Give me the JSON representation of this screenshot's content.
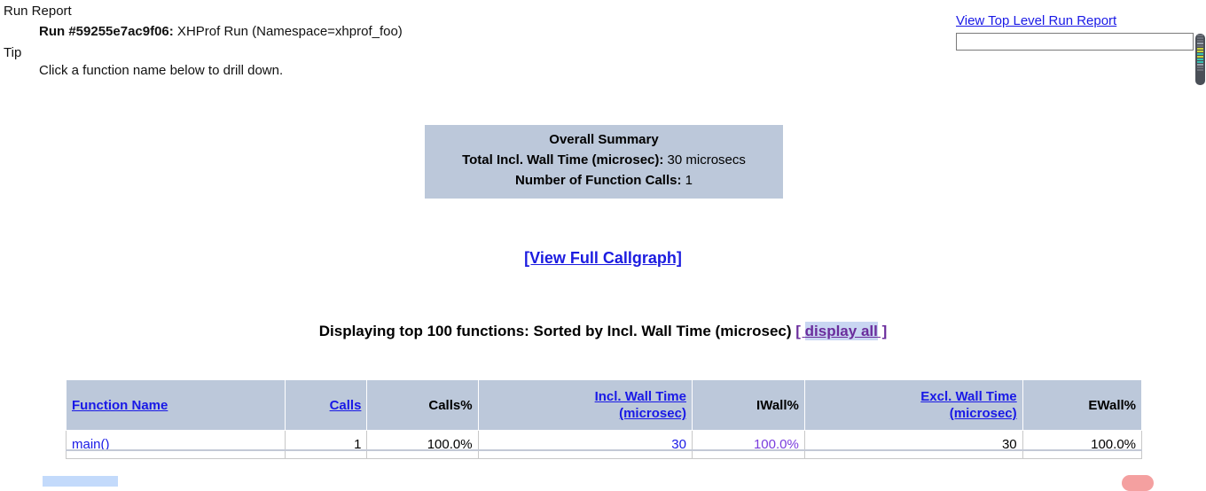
{
  "header": {
    "run_report_label": "Run Report",
    "run_id_label": "Run #59255e7ac9f06:",
    "run_description": " XHProf Run (Namespace=xhprof_foo)",
    "tip_label": "Tip",
    "tip_text": "Click a function name below to drill down."
  },
  "top_right": {
    "view_top_level_link": "View Top Level Run Report",
    "search_value": "",
    "search_placeholder": ""
  },
  "summary": {
    "title": "Overall Summary",
    "total_incl_wall_time_label": "Total Incl. Wall Time (microsec):",
    "total_incl_wall_time_value": " 30 microsecs",
    "number_of_function_calls_label": "Number of Function Calls:",
    "number_of_function_calls_value": " 1"
  },
  "callgraph": {
    "link_label": "[View Full Callgraph]"
  },
  "display_line": {
    "prefix": "Displaying top 100 functions: Sorted by Incl. Wall Time (microsec) ",
    "bracket_open": "[ ",
    "display_all_label": "display all",
    "bracket_close": " ]"
  },
  "table": {
    "headers": [
      {
        "label": "Function Name",
        "is_link": true,
        "align": "left"
      },
      {
        "label": "Calls",
        "is_link": true,
        "align": "right"
      },
      {
        "label": "Calls%",
        "is_link": false,
        "align": "right"
      },
      {
        "label": "Incl. Wall Time (microsec)",
        "is_link": true,
        "align": "right"
      },
      {
        "label": "IWall%",
        "is_link": false,
        "align": "right"
      },
      {
        "label": "Excl. Wall Time (microsec)",
        "is_link": true,
        "align": "right"
      },
      {
        "label": "EWall%",
        "is_link": false,
        "align": "right"
      }
    ],
    "header_labels": {
      "function_name": "Function Name",
      "calls": "Calls",
      "calls_pct": "Calls%",
      "incl_wall_time_line1": "Incl. Wall Time",
      "incl_wall_time_line2": "(microsec)",
      "iwall_pct": "IWall%",
      "excl_wall_time_line1": "Excl. Wall Time",
      "excl_wall_time_line2": "(microsec)",
      "ewall_pct": "EWall%"
    },
    "rows": [
      {
        "function_name": "main()",
        "calls": "1",
        "calls_pct": "100.0%",
        "incl_wall_time": "30",
        "iwall_pct": "100.0%",
        "excl_wall_time": "30",
        "ewall_pct": "100.0%"
      }
    ]
  },
  "colors": {
    "header_bg": "#bcc8da",
    "link_blue": "#1919e6",
    "visited_purple": "#6a2c9c",
    "selection_highlight": "#c9d6f2",
    "sorted_value_blue": "#1919e6",
    "sorted_pct_violet": "#7a3ddd"
  }
}
